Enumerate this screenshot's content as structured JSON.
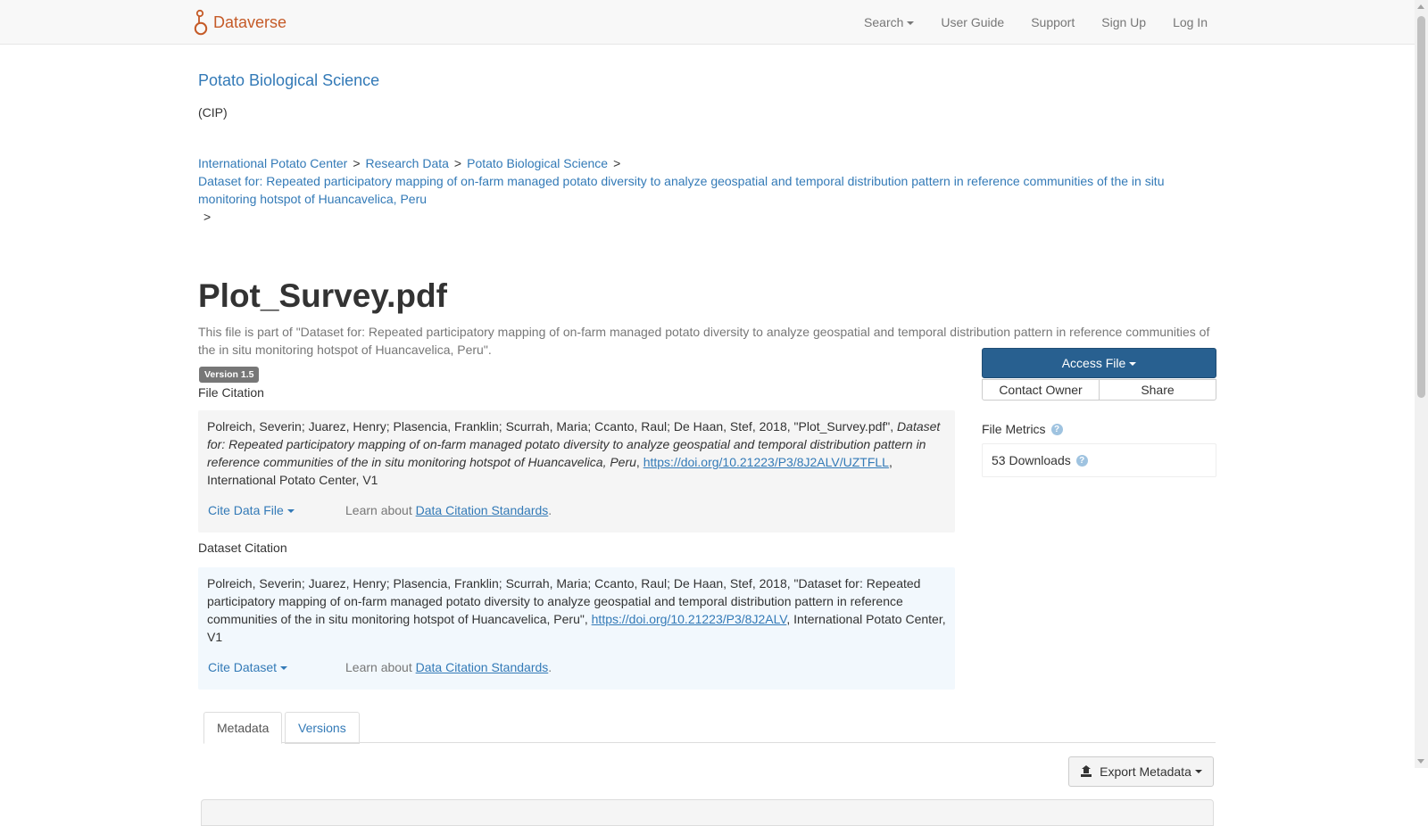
{
  "navbar": {
    "brand": "Dataverse",
    "search": "Search",
    "user_guide": "User Guide",
    "support": "Support",
    "sign_up": "Sign Up",
    "log_in": "Log In"
  },
  "dataverse": {
    "title": "Potato Biological Science",
    "affiliation": "(CIP)"
  },
  "breadcrumbs": {
    "items": [
      "International Potato Center",
      "Research Data",
      "Potato Biological Science"
    ],
    "dataset": "Dataset for: Repeated participatory mapping of on-farm managed potato diversity to analyze geospatial and temporal distribution pattern in reference communities of the in situ monitoring hotspot of Huancavelica, Peru",
    "separator": ">"
  },
  "file": {
    "title": "Plot_Survey.pdf",
    "part_of": "This file is part of \"Dataset for: Repeated participatory mapping of on-farm managed potato diversity to analyze geospatial and temporal distribution pattern in reference communities of the in situ monitoring hotspot of Huancavelica, Peru\".",
    "version": "Version 1.5"
  },
  "file_citation": {
    "label": "File Citation",
    "text_authors": "Polreich, Severin; Juarez, Henry; Plasencia, Franklin; Scurrah, Maria; Ccanto, Raul; De Haan, Stef, 2018, \"Plot_Survey.pdf\", ",
    "text_dataset": "Dataset for: Repeated participatory mapping of on-farm managed potato diversity to analyze geospatial and temporal distribution pattern in reference communities of the in situ monitoring hotspot of Huancavelica, Peru",
    "text_sep": ", ",
    "doi": "https://doi.org/10.21223/P3/8J2ALV/UZTFLL",
    "text_end": ", International Potato Center, V1",
    "cite_button": "Cite Data File",
    "learn_prefix": "Learn about ",
    "learn_link": "Data Citation Standards",
    "learn_suffix": "."
  },
  "dataset_citation": {
    "label": "Dataset Citation",
    "text": "Polreich, Severin; Juarez, Henry; Plasencia, Franklin; Scurrah, Maria; Ccanto, Raul; De Haan, Stef, 2018, \"Dataset for: Repeated participatory mapping of on-farm managed potato diversity to analyze geospatial and temporal distribution pattern in reference communities of the in situ monitoring hotspot of Huancavelica, Peru\", ",
    "doi": "https://doi.org/10.21223/P3/8J2ALV",
    "text_end": ", International Potato Center, V1",
    "cite_button": "Cite Dataset",
    "learn_prefix": "Learn about ",
    "learn_link": "Data Citation Standards",
    "learn_suffix": "."
  },
  "actions": {
    "access_file": "Access File",
    "contact_owner": "Contact Owner",
    "share": "Share"
  },
  "metrics": {
    "title": "File Metrics",
    "downloads": "53 Downloads",
    "help_glyph": "?"
  },
  "tabs": {
    "metadata": "Metadata",
    "versions": "Versions"
  },
  "export": {
    "label": "Export Metadata"
  },
  "colors": {
    "brand": "#c55b28",
    "link": "#337ab7",
    "primary": "#286090"
  }
}
